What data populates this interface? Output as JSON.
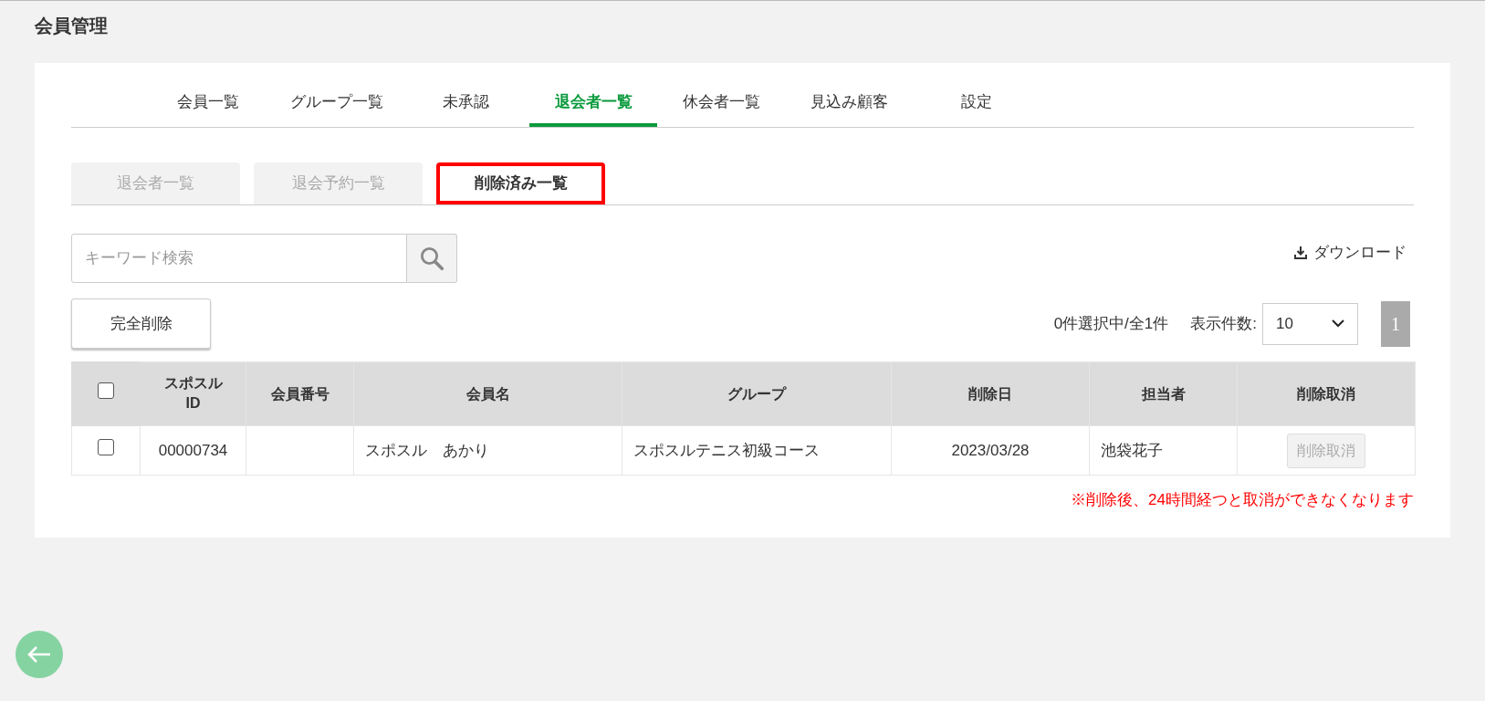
{
  "page_title": "会員管理",
  "tabs": [
    {
      "label": "会員一覧",
      "selected": false
    },
    {
      "label": "グループ一覧",
      "selected": false
    },
    {
      "label": "未承認",
      "selected": false
    },
    {
      "label": "退会者一覧",
      "selected": true
    },
    {
      "label": "休会者一覧",
      "selected": false
    },
    {
      "label": "見込み顧客",
      "selected": false
    },
    {
      "label": "設定",
      "selected": false
    }
  ],
  "subtabs": [
    {
      "label": "退会者一覧",
      "selected": false
    },
    {
      "label": "退会予約一覧",
      "selected": false
    },
    {
      "label": "削除済み一覧",
      "selected": true
    }
  ],
  "search": {
    "placeholder": "キーワード検索"
  },
  "download": "ダウンロード",
  "delete_button": "完全削除",
  "selection_count": "0件選択中/全1件",
  "per_page_label": "表示件数:",
  "per_page_value": "10",
  "pages": [
    {
      "label": "1",
      "selected": true
    }
  ],
  "table": {
    "select_all_checked": false,
    "columns": [
      "スポスル\nID",
      "会員番号",
      "会員名",
      "グループ",
      "削除日",
      "担当者",
      "削除取消"
    ],
    "rows": [
      {
        "checked": false,
        "cells": [
          "00000734",
          "",
          "スポスル　あかり",
          "スポスルテニス初級コース",
          "2023/03/28",
          "池袋花子"
        ],
        "action": {
          "label": "削除取消",
          "disabled": true
        }
      }
    ]
  },
  "note": "※削除後、24時間経つと取消ができなくなります"
}
